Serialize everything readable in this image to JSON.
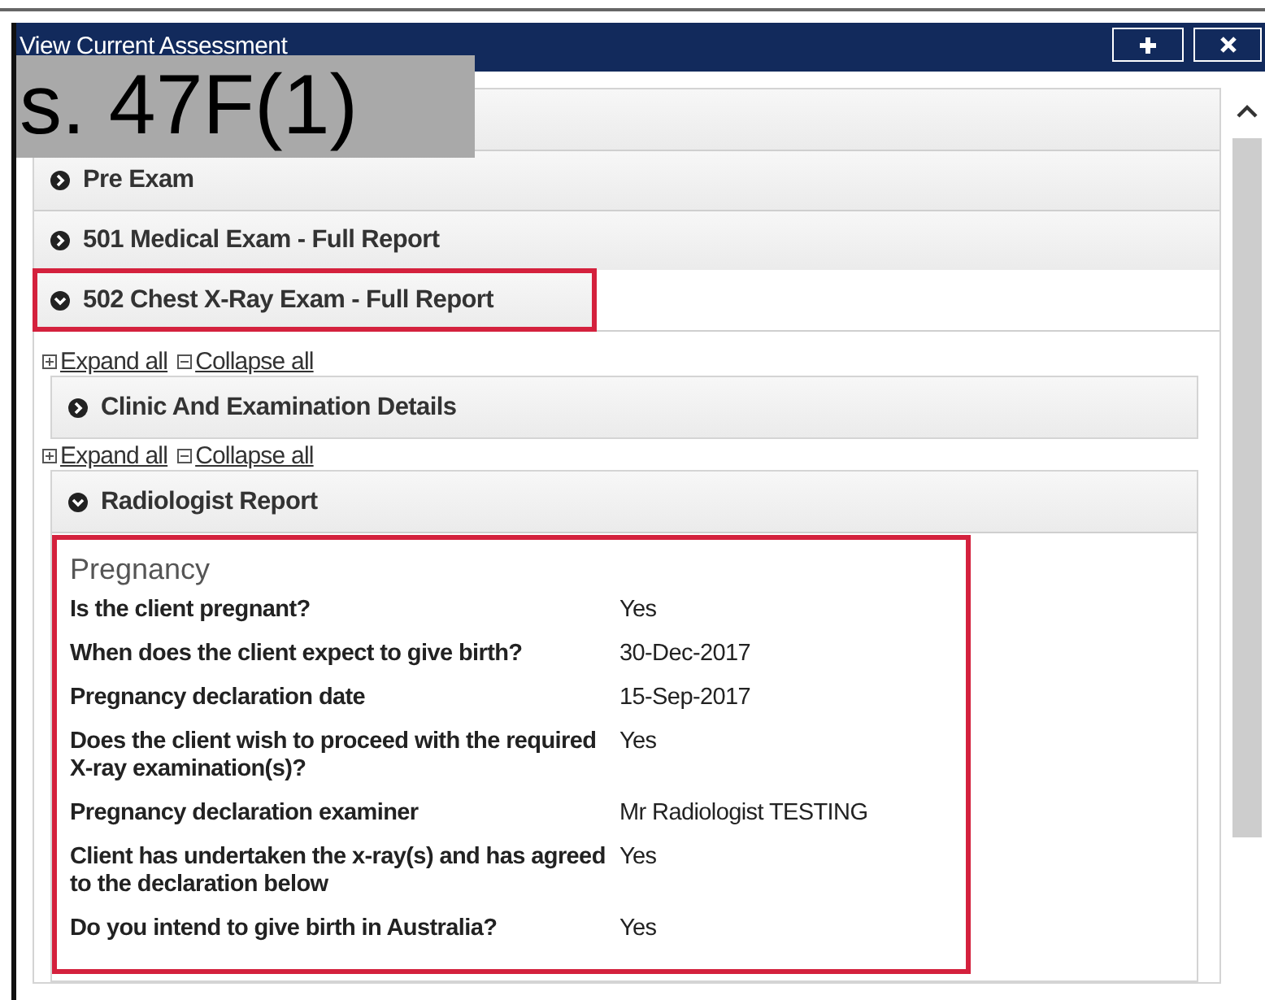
{
  "window": {
    "title": "View Current Assessment",
    "buttons": [
      {
        "kind": "add"
      },
      {
        "kind": "close"
      }
    ]
  },
  "redaction": {
    "label": "s. 47F(1)"
  },
  "sections": [
    {
      "highlighted": false
    },
    {
      "title": "Pre Exam",
      "expanded": false,
      "highlighted": false
    },
    {
      "title": "501 Medical Exam - Full Report",
      "expanded": false,
      "highlighted": false
    },
    {
      "title": "502 Chest X-Ray Exam - Full Report",
      "expanded": true,
      "highlighted": true,
      "subsections": [
        {
          "expand_label": "Expand all",
          "collapse_label": "Collapse all",
          "title": "Clinic And Examination Details",
          "expanded": false
        },
        {
          "expand_label": "Expand all",
          "collapse_label": "Collapse all",
          "title": "Radiologist Report",
          "expanded": true,
          "body": {
            "heading": "Pregnancy",
            "highlighted": true,
            "rows": [
              {
                "label": "Is the client pregnant?",
                "value": "Yes"
              },
              {
                "label": "When does the client expect to give birth?",
                "value": "30-Dec-2017"
              },
              {
                "label": "Pregnancy declaration date",
                "value": "15-Sep-2017"
              },
              {
                "label": "Does the client wish to proceed with the required X-ray examination(s)?",
                "value": "Yes"
              },
              {
                "label": "Pregnancy declaration examiner",
                "value": "Mr Radiologist TESTING"
              },
              {
                "label": "Client has undertaken the x-ray(s) and has agreed to the declaration below",
                "value": "Yes"
              },
              {
                "label": "Do you intend to give birth in Australia?",
                "value": "Yes"
              }
            ]
          }
        }
      ]
    }
  ]
}
